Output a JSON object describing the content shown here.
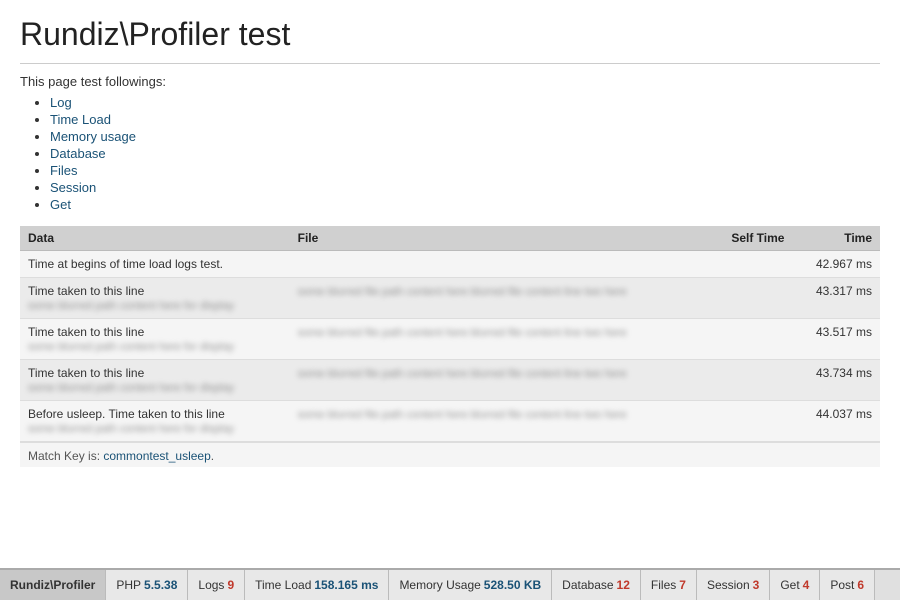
{
  "page": {
    "title": "Rundiz\\Profiler test",
    "intro": "This page test followings:",
    "features": [
      {
        "label": "Log",
        "href": "#log"
      },
      {
        "label": "Time Load",
        "href": "#timeload"
      },
      {
        "label": "Memory usage",
        "href": "#memory"
      },
      {
        "label": "Database",
        "href": "#database"
      },
      {
        "label": "Files",
        "href": "#files"
      },
      {
        "label": "Session",
        "href": "#session"
      },
      {
        "label": "Get",
        "href": "#get"
      }
    ]
  },
  "table": {
    "columns": [
      {
        "key": "data",
        "label": "Data"
      },
      {
        "key": "file",
        "label": "File"
      },
      {
        "key": "self_time",
        "label": "Self Time"
      },
      {
        "key": "time",
        "label": "Time"
      }
    ],
    "rows": [
      {
        "data": "Time at begins of time load logs test.",
        "data_blurred": "",
        "file": "",
        "file_blurred": "",
        "self_time": "",
        "time": "42.967 ms"
      },
      {
        "data": "Time taken to this line",
        "data_blurred": "some blurred path content here for display",
        "file": "",
        "file_blurred": "some blurred file path content here",
        "self_time": "",
        "time": "43.317 ms"
      },
      {
        "data": "Time taken to this line",
        "data_blurred": "some blurred path content here for display",
        "file": "",
        "file_blurred": "some blurred file path content here",
        "self_time": "",
        "time": "43.517 ms"
      },
      {
        "data": "Time taken to this line",
        "data_blurred": "some blurred path content here for display",
        "file": "",
        "file_blurred": "some blurred file path content here",
        "self_time": "",
        "time": "43.734 ms"
      },
      {
        "data": "Before usleep. Time taken to this line",
        "data_blurred": "some blurred path content here for display",
        "file": "",
        "file_blurred": "some blurred file path content here",
        "self_time": "",
        "time": "44.037 ms"
      }
    ],
    "match_key_label": "Match Key is:",
    "match_key_value": "commontest_usleep"
  },
  "tabs": [
    {
      "id": "rundiz-profiler",
      "label": "Rundiz\\Profiler",
      "badge": "",
      "value": "",
      "active": true
    },
    {
      "id": "php",
      "label": "PHP",
      "badge": "",
      "value": "5.5.38",
      "active": false
    },
    {
      "id": "logs",
      "label": "Logs",
      "badge": "9",
      "value": "",
      "active": false
    },
    {
      "id": "time-load",
      "label": "Time Load",
      "badge": "",
      "value": "158.165 ms",
      "active": false
    },
    {
      "id": "memory-usage",
      "label": "Memory Usage",
      "badge": "",
      "value": "528.50 KB",
      "active": false
    },
    {
      "id": "database",
      "label": "Database",
      "badge": "12",
      "value": "",
      "active": false
    },
    {
      "id": "files",
      "label": "Files",
      "badge": "7",
      "value": "",
      "active": false
    },
    {
      "id": "session",
      "label": "Session",
      "badge": "3",
      "value": "",
      "active": false
    },
    {
      "id": "get",
      "label": "Get",
      "badge": "4",
      "value": "",
      "active": false
    },
    {
      "id": "post",
      "label": "Post",
      "badge": "6",
      "value": "",
      "active": false
    }
  ]
}
